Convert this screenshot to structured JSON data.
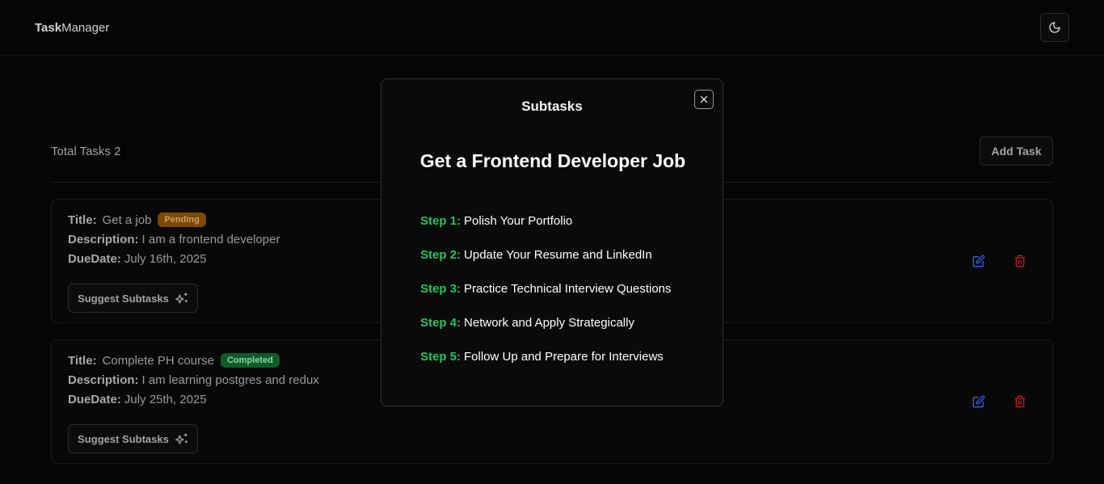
{
  "navbar": {
    "logo_bold": "Task",
    "logo_rest": "Manager",
    "theme_icon": "moon-icon"
  },
  "toolbar": {
    "total_label": "Total Tasks 2",
    "add_task_label": "Add Task"
  },
  "tasks": [
    {
      "title_label": "Title:",
      "title": "Get a job",
      "status": "Pending",
      "description_label": "Description:",
      "description": "I am a frontend developer",
      "due_label": "DueDate:",
      "due": "July 16th, 2025",
      "suggest_label": "Suggest Subtasks"
    },
    {
      "title_label": "Title:",
      "title": "Complete PH course",
      "status": "Completed",
      "description_label": "Description:",
      "description": "I am learning postgres and redux",
      "due_label": "DueDate:",
      "due": "July 25th, 2025",
      "suggest_label": "Suggest Subtasks"
    }
  ],
  "modal": {
    "title": "Subtasks",
    "goal": "Get a Frontend Developer Job",
    "steps": [
      {
        "num": "Step 1:",
        "text": "Polish Your Portfolio"
      },
      {
        "num": "Step 2:",
        "text": "Update Your Resume and LinkedIn"
      },
      {
        "num": "Step 3:",
        "text": "Practice Technical Interview Questions"
      },
      {
        "num": "Step 4:",
        "text": "Network and Apply Strategically"
      },
      {
        "num": "Step 5:",
        "text": "Follow Up and Prepare for Interviews"
      }
    ]
  },
  "colors": {
    "accent_green": "#22c55e",
    "pending_badge": "#7a4a05",
    "completed_badge": "#0f5a26",
    "edit_icon": "#2563eb",
    "delete_icon": "#b91c1c"
  }
}
